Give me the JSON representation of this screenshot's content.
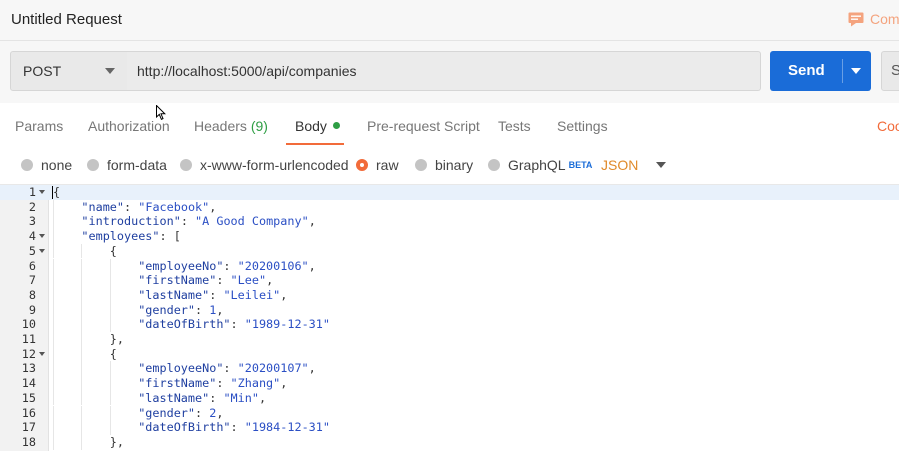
{
  "window": {
    "title": "Untitled Request",
    "comments_label": "Com"
  },
  "request": {
    "method": "POST",
    "url": "http://localhost:5000/api/companies",
    "send_label": "Send",
    "save_label": "Sa"
  },
  "tabs": {
    "params": "Params",
    "authorization": "Authorization",
    "headers": "Headers",
    "headers_count": "(9)",
    "body": "Body",
    "prerequest": "Pre-request Script",
    "tests": "Tests",
    "settings": "Settings",
    "cookies": "Coo"
  },
  "body_types": {
    "none": "none",
    "form_data": "form-data",
    "urlencoded": "x-www-form-urlencoded",
    "raw": "raw",
    "binary": "binary",
    "graphql": "GraphQL",
    "beta": "BETA",
    "selected": "raw",
    "format": "JSON"
  },
  "editor": {
    "lines": [
      {
        "n": "1",
        "fold": true,
        "indent": 0,
        "text": "{"
      },
      {
        "n": "2",
        "fold": false,
        "indent": 1,
        "key": "\"name\"",
        "val": "\"Facebook\"",
        "end": ","
      },
      {
        "n": "3",
        "fold": false,
        "indent": 1,
        "key": "\"introduction\"",
        "val": "\"A Good Company\"",
        "end": ","
      },
      {
        "n": "4",
        "fold": true,
        "indent": 1,
        "key": "\"employees\"",
        "val": "",
        "end": "["
      },
      {
        "n": "5",
        "fold": true,
        "indent": 2,
        "text": "{"
      },
      {
        "n": "6",
        "fold": false,
        "indent": 3,
        "key": "\"employeeNo\"",
        "val": "\"20200106\"",
        "end": ","
      },
      {
        "n": "7",
        "fold": false,
        "indent": 3,
        "key": "\"firstName\"",
        "val": "\"Lee\"",
        "end": ","
      },
      {
        "n": "8",
        "fold": false,
        "indent": 3,
        "key": "\"lastName\"",
        "val": "\"Leilei\"",
        "end": ","
      },
      {
        "n": "9",
        "fold": false,
        "indent": 3,
        "key": "\"gender\"",
        "val": "1",
        "end": ","
      },
      {
        "n": "10",
        "fold": false,
        "indent": 3,
        "key": "\"dateOfBirth\"",
        "val": "\"1989-12-31\"",
        "end": ""
      },
      {
        "n": "11",
        "fold": false,
        "indent": 2,
        "text": "},"
      },
      {
        "n": "12",
        "fold": true,
        "indent": 2,
        "text": "{"
      },
      {
        "n": "13",
        "fold": false,
        "indent": 3,
        "key": "\"employeeNo\"",
        "val": "\"20200107\"",
        "end": ","
      },
      {
        "n": "14",
        "fold": false,
        "indent": 3,
        "key": "\"firstName\"",
        "val": "\"Zhang\"",
        "end": ","
      },
      {
        "n": "15",
        "fold": false,
        "indent": 3,
        "key": "\"lastName\"",
        "val": "\"Min\"",
        "end": ","
      },
      {
        "n": "16",
        "fold": false,
        "indent": 3,
        "key": "\"gender\"",
        "val": "2",
        "end": ","
      },
      {
        "n": "17",
        "fold": false,
        "indent": 3,
        "key": "\"dateOfBirth\"",
        "val": "\"1984-12-31\"",
        "end": ""
      },
      {
        "n": "18",
        "fold": false,
        "indent": 2,
        "text": "},"
      }
    ]
  },
  "colors": {
    "accent": "#f26b3a",
    "send": "#1a6cd8",
    "count": "#2e9e44",
    "json_label": "#e08a2a"
  }
}
